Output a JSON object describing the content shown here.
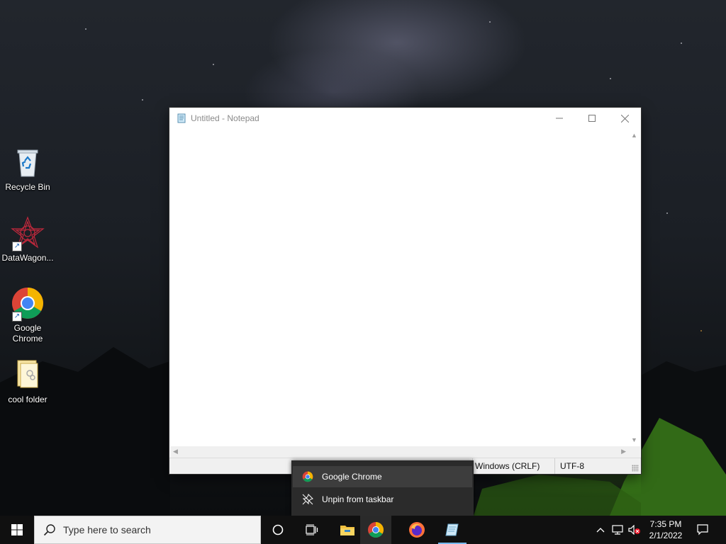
{
  "desktop": {
    "icons": [
      {
        "label": "Recycle Bin",
        "icon": "recycle-bin-icon"
      },
      {
        "label": "DataWagon...",
        "icon": "datawagon-icon"
      },
      {
        "label": "Google Chrome",
        "icon": "chrome-icon"
      },
      {
        "label": "cool folder",
        "icon": "folder-icon"
      }
    ]
  },
  "notepad": {
    "title": "Untitled - Notepad",
    "content": "",
    "status": {
      "line_ending": "Windows (CRLF)",
      "encoding": "UTF-8"
    }
  },
  "jumplist": {
    "items": [
      {
        "label": "Google Chrome",
        "icon": "chrome-icon"
      },
      {
        "label": "Unpin from taskbar",
        "icon": "unpin-icon"
      }
    ]
  },
  "taskbar": {
    "search_placeholder": "Type here to search",
    "apps": [
      {
        "name": "File Explorer",
        "icon": "file-explorer-icon"
      },
      {
        "name": "Google Chrome",
        "icon": "chrome-icon"
      },
      {
        "name": "Firefox",
        "icon": "firefox-icon"
      },
      {
        "name": "Notepad",
        "icon": "notepad-icon"
      }
    ],
    "clock": {
      "time": "7:35 PM",
      "date": "2/1/2022"
    }
  },
  "colors": {
    "taskbar_bg": "#101010",
    "jumplist_bg": "#2b2b2b",
    "accent_running": "#76b9ed"
  }
}
